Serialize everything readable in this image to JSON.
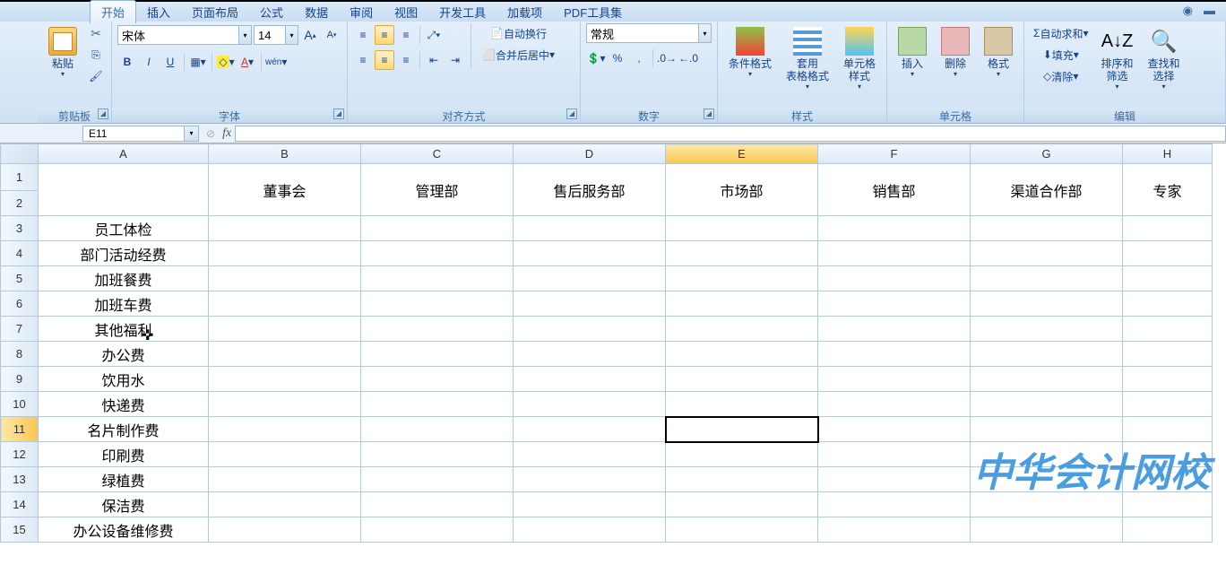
{
  "tabs": [
    "开始",
    "插入",
    "页面布局",
    "公式",
    "数据",
    "审阅",
    "视图",
    "开发工具",
    "加载项",
    "PDF工具集"
  ],
  "activeTab": 0,
  "help": {
    "q": "?",
    "min": "–"
  },
  "ribbon": {
    "clipboard": {
      "label": "剪贴板",
      "paste": "粘贴"
    },
    "font": {
      "label": "字体",
      "name": "宋体",
      "size": "14",
      "bold": "B",
      "italic": "I",
      "underline": "U",
      "growA": "A",
      "shrinkA": "A"
    },
    "align": {
      "label": "对齐方式",
      "wrap": "自动换行",
      "merge": "合并后居中"
    },
    "number": {
      "label": "数字",
      "format": "常规"
    },
    "styles": {
      "label": "样式",
      "cond": "条件格式",
      "table": "套用\n表格格式",
      "cell": "单元格\n样式"
    },
    "cells": {
      "label": "单元格",
      "insert": "插入",
      "delete": "删除",
      "format": "格式"
    },
    "edit": {
      "label": "编辑",
      "sum": "自动求和",
      "fill": "填充",
      "clear": "清除",
      "sort": "排序和\n筛选",
      "find": "查找和\n选择"
    }
  },
  "nameBox": "E11",
  "columns": [
    "A",
    "B",
    "C",
    "D",
    "E",
    "F",
    "G",
    "H"
  ],
  "activeCol": 4,
  "activeRow": 11,
  "headerRow": [
    "",
    "董事会",
    "管理部",
    "售后服务部",
    "市场部",
    "销售部",
    "渠道合作部",
    "专家"
  ],
  "rows": [
    {
      "n": 3,
      "a": "员工体检"
    },
    {
      "n": 4,
      "a": "部门活动经费"
    },
    {
      "n": 5,
      "a": "加班餐费"
    },
    {
      "n": 6,
      "a": "加班车费"
    },
    {
      "n": 7,
      "a": "其他福利"
    },
    {
      "n": 8,
      "a": "办公费"
    },
    {
      "n": 9,
      "a": "饮用水"
    },
    {
      "n": 10,
      "a": "快递费"
    },
    {
      "n": 11,
      "a": "名片制作费"
    },
    {
      "n": 12,
      "a": "印刷费"
    },
    {
      "n": 13,
      "a": "绿植费"
    },
    {
      "n": 14,
      "a": "保洁费"
    },
    {
      "n": 15,
      "a": "办公设备维修费"
    }
  ],
  "watermark": "中华会计网校"
}
